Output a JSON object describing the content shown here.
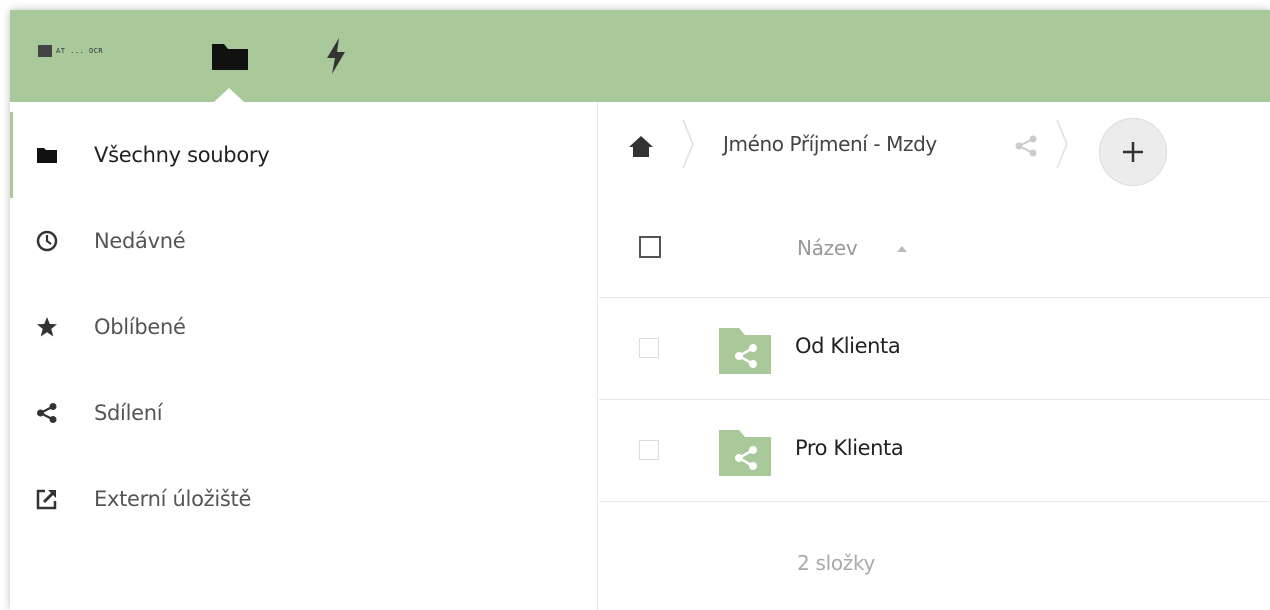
{
  "header": {
    "logo_text": "AT ... OCR",
    "apps": [
      {
        "name": "Files",
        "icon": "folder-icon",
        "active": true
      },
      {
        "name": "Activity",
        "icon": "lightning-icon",
        "active": false
      }
    ],
    "background_color": "#a9c99b"
  },
  "sidebar": {
    "items": [
      {
        "label": "Všechny soubory",
        "icon": "folder-icon",
        "active": true
      },
      {
        "label": "Nedávné",
        "icon": "clock-icon",
        "active": false
      },
      {
        "label": "Oblíbené",
        "icon": "star-icon",
        "active": false
      },
      {
        "label": "Sdílení",
        "icon": "share-icon",
        "active": false
      },
      {
        "label": "Externí úložiště",
        "icon": "external-link-icon",
        "active": false
      }
    ]
  },
  "breadcrumb": {
    "home_icon": "home-icon",
    "current_folder": "Jméno Příjmení - Mzdy",
    "share_icon": "share-icon",
    "add_label": "+"
  },
  "table": {
    "column_name": "Název",
    "sort": "ascending",
    "rows": [
      {
        "name": "Od Klienta",
        "type": "shared-folder"
      },
      {
        "name": "Pro Klienta",
        "type": "shared-folder"
      }
    ],
    "summary": "2 složky"
  },
  "colors": {
    "accent": "#a9c99b",
    "folder": "#a9c99b"
  }
}
